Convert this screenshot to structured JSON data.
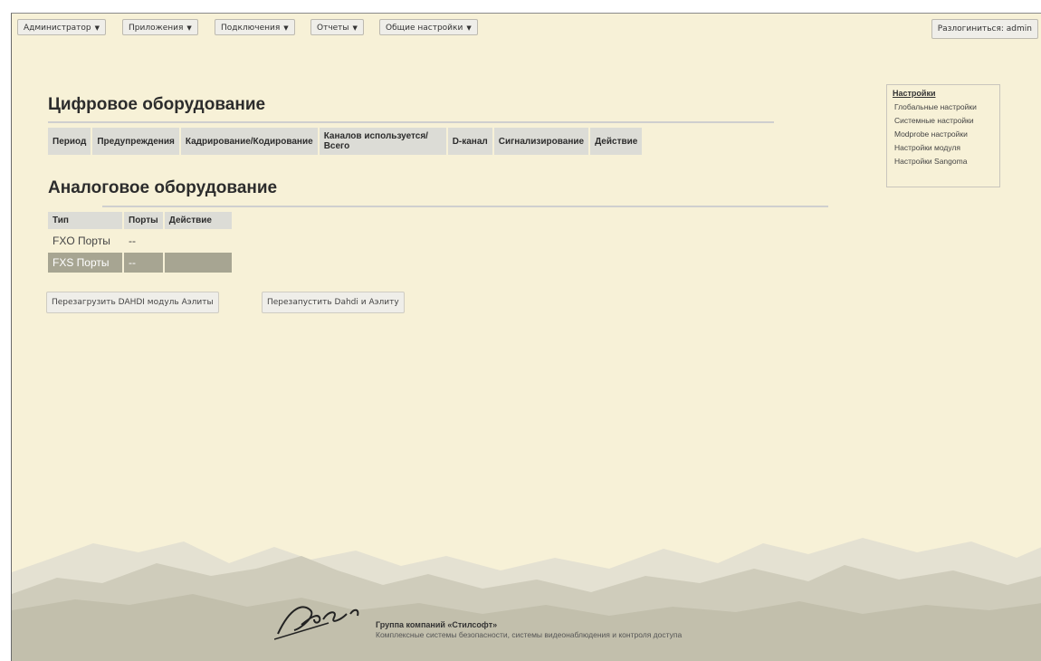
{
  "topbar": {
    "menus": [
      {
        "label": "Администратор"
      },
      {
        "label": "Приложения"
      },
      {
        "label": "Подключения"
      },
      {
        "label": "Отчеты"
      },
      {
        "label": "Общие настройки"
      }
    ],
    "logout_label": "Разлогиниться: admin"
  },
  "digital": {
    "title": "Цифровое оборудование",
    "columns": [
      "Период",
      "Предупреждения",
      "Кадрирование/Кодирование",
      "Каналов используется/Всего",
      "D-канал",
      "Сигнализирование",
      "Действие"
    ]
  },
  "analog": {
    "title": "Аналоговое оборудование",
    "columns": [
      "Тип",
      "Порты",
      "Действие"
    ],
    "rows": [
      {
        "type": "FXO Порты",
        "ports": "--",
        "action": ""
      },
      {
        "type": "FXS Порты",
        "ports": "--",
        "action": ""
      }
    ]
  },
  "actions": {
    "reload_label": "Перезагрузить DAHDI модуль Аэлиты",
    "restart_label": "Перезапустить Dahdi и Аэлиту"
  },
  "side_panel": {
    "title": "Настройки",
    "items": [
      {
        "label": "Глобальные настройки"
      },
      {
        "label": "Системные настройки"
      },
      {
        "label": "Modprobe настройки"
      },
      {
        "label": "Настройки модуля"
      },
      {
        "label": "Настройки Sangoma"
      }
    ]
  },
  "footer": {
    "company": "Группа компаний «Стилсофт»",
    "description": "Комплексные системы безопасности, системы видеонаблюдения и контроля доступа"
  },
  "colors": {
    "background": "#f7f1d7",
    "header_cell": "#dcdcd6",
    "highlight_row": "#a7a592"
  }
}
